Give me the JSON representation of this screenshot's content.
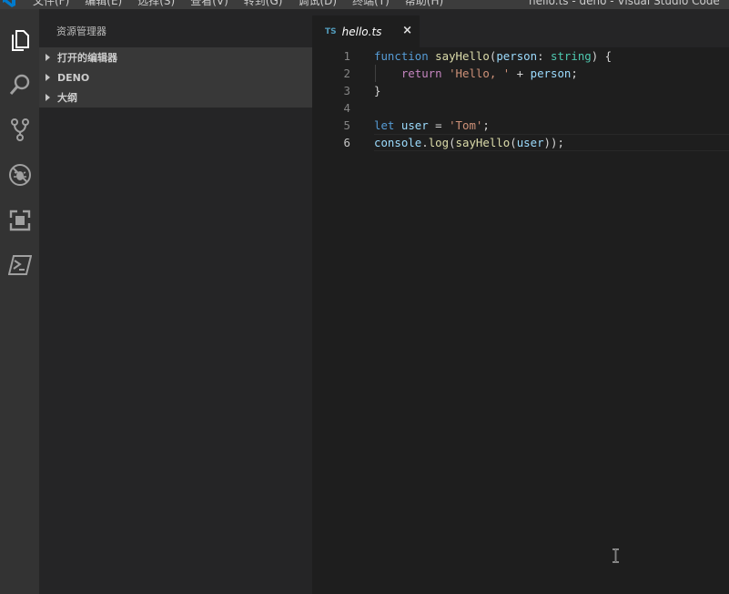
{
  "window": {
    "title": "hello.ts - deno - Visual Studio Code",
    "menu": [
      "文件(F)",
      "编辑(E)",
      "选择(S)",
      "查看(V)",
      "转到(G)",
      "调试(D)",
      "终端(T)",
      "帮助(H)"
    ]
  },
  "activitybar": {
    "items": [
      {
        "name": "explorer",
        "icon": "files-icon"
      },
      {
        "name": "search",
        "icon": "search-icon"
      },
      {
        "name": "source-control",
        "icon": "source-control-icon"
      },
      {
        "name": "debug",
        "icon": "debug-icon"
      },
      {
        "name": "extensions",
        "icon": "extensions-icon"
      },
      {
        "name": "powershell",
        "icon": "terminal-icon"
      }
    ]
  },
  "sidebar": {
    "title": "资源管理器",
    "sections": [
      {
        "label": "打开的编辑器"
      },
      {
        "label": "DENO"
      },
      {
        "label": "大纲"
      }
    ]
  },
  "editor": {
    "tab": {
      "icon_text": "TS",
      "label": "hello.ts",
      "close": "×"
    },
    "active_line": 6,
    "lines": [
      {
        "num": "1",
        "tokens": [
          [
            "kw",
            "function"
          ],
          [
            "pn",
            " "
          ],
          [
            "fn",
            "sayHello"
          ],
          [
            "pn",
            "("
          ],
          [
            "var",
            "person"
          ],
          [
            "pn",
            ": "
          ],
          [
            "ty",
            "string"
          ],
          [
            "pn",
            ") {"
          ]
        ]
      },
      {
        "num": "2",
        "tokens": [
          [
            "pn",
            "    "
          ],
          [
            "kw2",
            "return"
          ],
          [
            "pn",
            " "
          ],
          [
            "str",
            "'Hello, '"
          ],
          [
            "pn",
            " + "
          ],
          [
            "var",
            "person"
          ],
          [
            "pn",
            ";"
          ]
        ]
      },
      {
        "num": "3",
        "tokens": [
          [
            "pn",
            "}"
          ]
        ]
      },
      {
        "num": "4",
        "tokens": []
      },
      {
        "num": "5",
        "tokens": [
          [
            "kw",
            "let"
          ],
          [
            "pn",
            " "
          ],
          [
            "var",
            "user"
          ],
          [
            "pn",
            " = "
          ],
          [
            "str",
            "'Tom'"
          ],
          [
            "pn",
            ";"
          ]
        ]
      },
      {
        "num": "6",
        "tokens": [
          [
            "var",
            "console"
          ],
          [
            "pn",
            "."
          ],
          [
            "fn",
            "log"
          ],
          [
            "pn",
            "("
          ],
          [
            "fn",
            "sayHello"
          ],
          [
            "pn",
            "("
          ],
          [
            "var",
            "user"
          ],
          [
            "pn",
            "));"
          ]
        ]
      }
    ]
  },
  "colors": {
    "activitybar": "#333333",
    "sidebar": "#252526",
    "editor": "#1e1e1e",
    "accent": "#007acc"
  }
}
